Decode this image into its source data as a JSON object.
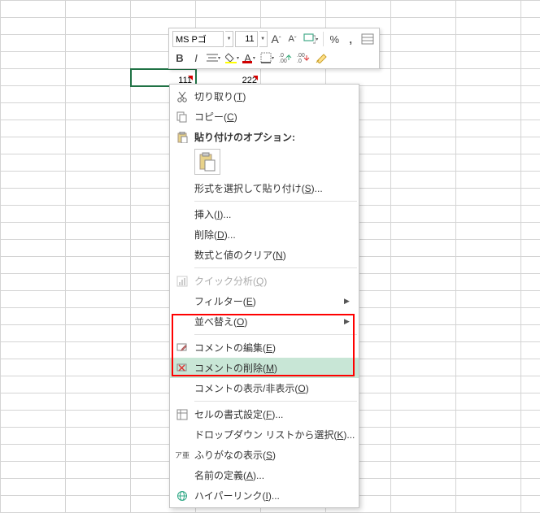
{
  "cells": {
    "c1": "111",
    "c2": "222"
  },
  "toolbar": {
    "font": "MS Pゴ",
    "size": "11",
    "incFont": "A",
    "decFont": "A",
    "bold": "B",
    "italic": "I",
    "percent": "%",
    "comma": ",",
    "incDec": ".0",
    "decDec": ".00"
  },
  "menu": {
    "cut": "切り取り",
    "cut_k": "T",
    "copy": "コピー",
    "copy_k": "C",
    "pasteopts": "貼り付けのオプション:",
    "pastespecial": "形式を選択して貼り付け",
    "pastespecial_k": "S",
    "insert": "挿入",
    "insert_k": "I",
    "delete": "削除",
    "delete_k": "D",
    "clear": "数式と値のクリア",
    "clear_k": "N",
    "quick": "クイック分析",
    "quick_k": "Q",
    "filter": "フィルター",
    "filter_k": "E",
    "sort": "並べ替え",
    "sort_k": "O",
    "editcomment": "コメントの編集",
    "editcomment_k": "E",
    "delcomment": "コメントの削除",
    "delcomment_k": "M",
    "togglecomment": "コメントの表示/非表示",
    "togglecomment_k": "O",
    "formatcell": "セルの書式設定",
    "formatcell_k": "F",
    "dropdown": "ドロップダウン リストから選択",
    "dropdown_k": "K",
    "furigana": "ふりがなの表示",
    "furigana_k": "S",
    "definename": "名前の定義",
    "definename_k": "A",
    "hyperlink": "ハイパーリンク",
    "hyperlink_k": "I"
  }
}
